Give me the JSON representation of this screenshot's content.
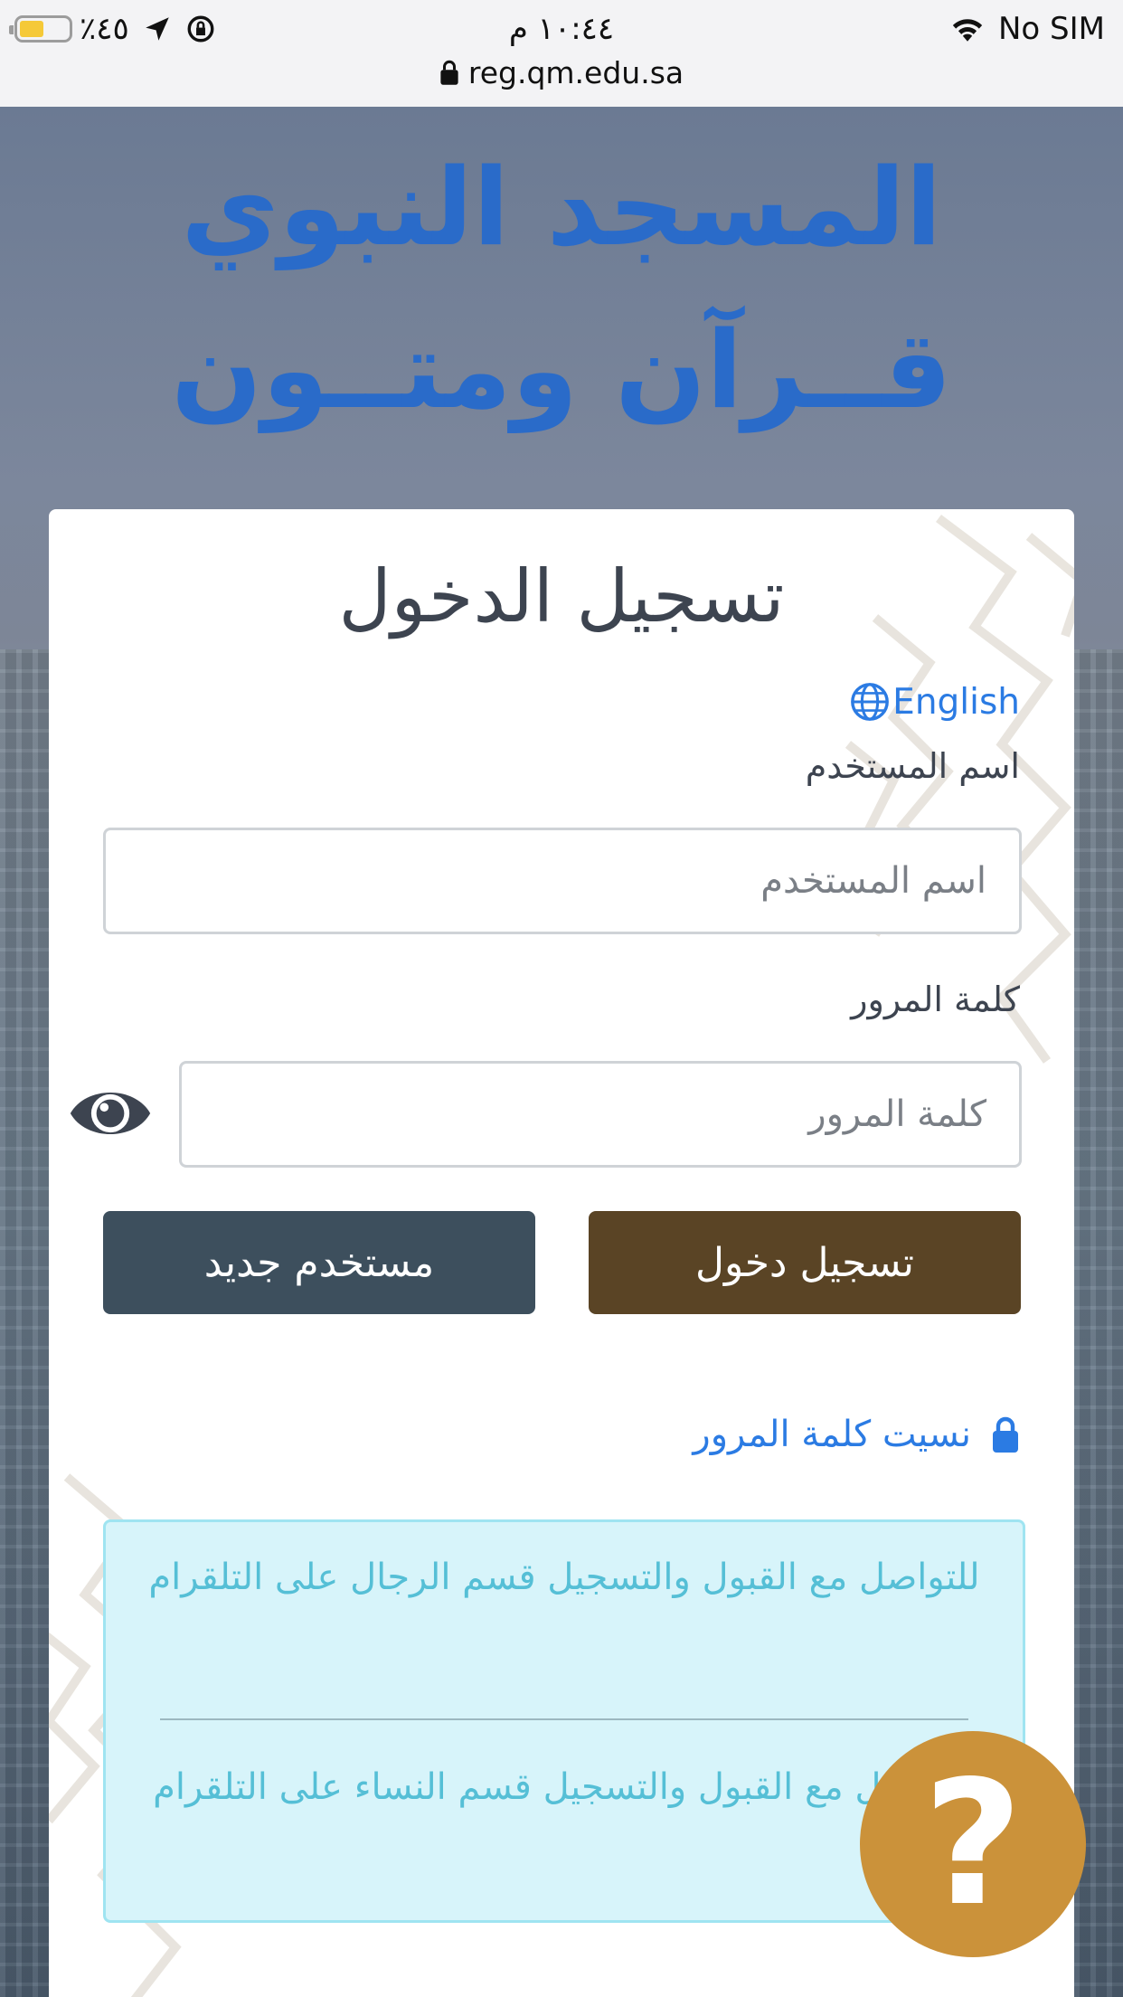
{
  "status_bar": {
    "battery_text": "٪٤٥",
    "time": "١٠:٤٤ م",
    "carrier": "No SIM",
    "url": "reg.qm.edu.sa",
    "battery_color": "#f5c938"
  },
  "hero": {
    "title_line1": "المسجد النبوي",
    "title_line2": "قــرآن ومتــون"
  },
  "login": {
    "title": "تسجيل الدخول",
    "language_link": "English",
    "username_label": "اسم المستخدم",
    "username_placeholder": "اسم المستخدم",
    "password_label": "كلمة المرور",
    "password_placeholder": "كلمة المرور",
    "login_button": "تسجيل دخول",
    "new_user_button": "مستخدم جديد",
    "forgot_password": "نسيت كلمة المرور"
  },
  "contact": {
    "men": "للتواصل مع القبول والتسجيل قسم الرجال على التلقرام",
    "women": "للتواصل مع القبول والتسجيل قسم النساء على التلقرام"
  },
  "help_button": "?",
  "colors": {
    "brand_blue": "#2a6bc9",
    "login_button": "#5a4425",
    "new_user_button": "#3d4f5d",
    "link": "#2b7be3",
    "help_button": "#cb923a",
    "info_box": "#d7f4fa"
  }
}
